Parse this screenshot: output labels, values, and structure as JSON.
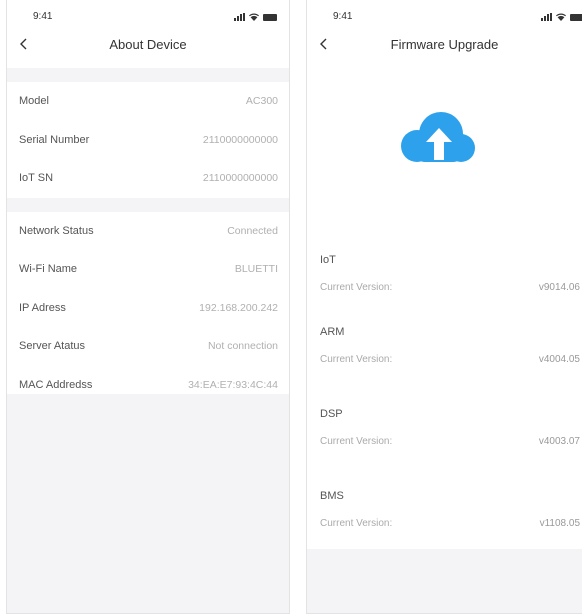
{
  "colors": {
    "accent": "#2ea1ec",
    "page_bg": "#f4f4f6",
    "value_text": "#b0b0b0"
  },
  "about": {
    "status_time": "9:41",
    "title": "About Device",
    "rows_group1": [
      {
        "label": "Model",
        "value": "AC300"
      },
      {
        "label": "Serial Number",
        "value": "2110000000000"
      },
      {
        "label": "IoT SN",
        "value": "2110000000000"
      }
    ],
    "rows_group2": [
      {
        "label": "Network Status",
        "value": "Connected"
      },
      {
        "label": "Wi-Fi Name",
        "value": "BLUETTI"
      },
      {
        "label": "IP Adress",
        "value": "192.168.200.242"
      },
      {
        "label": "Server Atatus",
        "value": "Not connection"
      },
      {
        "label": "MAC Addredss",
        "value": "34:EA:E7:93:4C:44"
      }
    ]
  },
  "firmware": {
    "status_time": "9:41",
    "title": "Firmware Upgrade",
    "icon": "cloud-upload-icon",
    "items": [
      {
        "name": "IoT",
        "label": "Current Version:",
        "version": "v9014.06"
      },
      {
        "name": "ARM",
        "label": "Current Version:",
        "version": "v4004.05"
      },
      {
        "name": "DSP",
        "label": "Current Version:",
        "version": "v4003.07"
      },
      {
        "name": "BMS",
        "label": "Current Version:",
        "version": "v1108.05"
      }
    ]
  }
}
